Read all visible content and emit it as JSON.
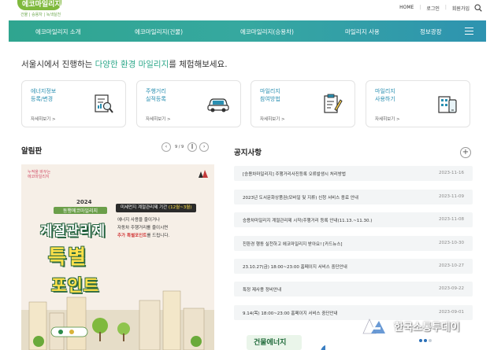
{
  "header": {
    "logo_text": "에코마일리지",
    "logo_sub": "건물 | 승용차 | 녹색실천",
    "util_links": [
      "HOME",
      "로그인",
      "회원가입"
    ]
  },
  "nav": {
    "items": [
      "에코마일리지 소개",
      "에코마일리지(건물)",
      "에코마일리지(승용차)",
      "마일리지 사용",
      "정보광장"
    ]
  },
  "intro": {
    "prefix": "서울시에서 진행하는 ",
    "highlight": "다양한 환경 마일리지",
    "suffix": "를 체험해보세요."
  },
  "cards": [
    {
      "title": "에너지정보\n등록/변경",
      "more": "자세히보기 >",
      "icon": "document-magnifier-icon"
    },
    {
      "title": "주행거리\n실적등록",
      "more": "자세히보기 >",
      "icon": "car-icon"
    },
    {
      "title": "마일리지\n참여방법",
      "more": "자세히보기 >",
      "icon": "clipboard-pencil-icon"
    },
    {
      "title": "마일리지\n사용하기",
      "more": "자세히보기 >",
      "icon": "building-phone-icon"
    }
  ],
  "board": {
    "title": "알림판",
    "page": "9 / 9"
  },
  "notices": {
    "title": "공지사항",
    "items": [
      {
        "text": "[승용차마일리지] 주행거리사진등록 오류발생시 처리방법",
        "date": "2023-11-16"
      },
      {
        "text": "2023년 도서문화상품권(모바일 및 지류) 신청 서비스 종료 안내",
        "date": "2023-11-09"
      },
      {
        "text": "승용차마일리지 계절관리제 시작(주행거리 등록 안내(11.13.~11.30.)",
        "date": "2023-11-08"
      },
      {
        "text": "친환경 행동 실천하고 에코마일리지 받아요! [카드뉴스]",
        "date": "2023-10-30"
      },
      {
        "text": "23.10.27(금) 18:00~23:00 홈페이지 서비스 중단안내",
        "date": "2023-10-27"
      },
      {
        "text": "특정 제사용 정비안내",
        "date": "2023-09-22"
      },
      {
        "text": "9.14(목) 18:00~23:00 홈페이지 서비스 중단안내",
        "date": "2023-09-01"
      }
    ]
  },
  "banner": {
    "tag": "누적을 바꾸는\n에코마일리지",
    "pill_text": "미세먼지 계절관리제 기간",
    "pill_period": "(12월~3월)",
    "desc_line1": "에너지 사용을 줄이거나",
    "desc_line2": "자동차 주행거리를 줄이시면",
    "desc_red": "추가 특별포인트",
    "desc_end": "를 드립니다.",
    "year": "2024",
    "sub": "동행에코마일리지",
    "big1": "계절관리제",
    "big2": "특별",
    "big3": "포인트"
  },
  "bottom": {
    "text": "건물에너지"
  },
  "watermark": {
    "text": "한국소통투데이"
  }
}
